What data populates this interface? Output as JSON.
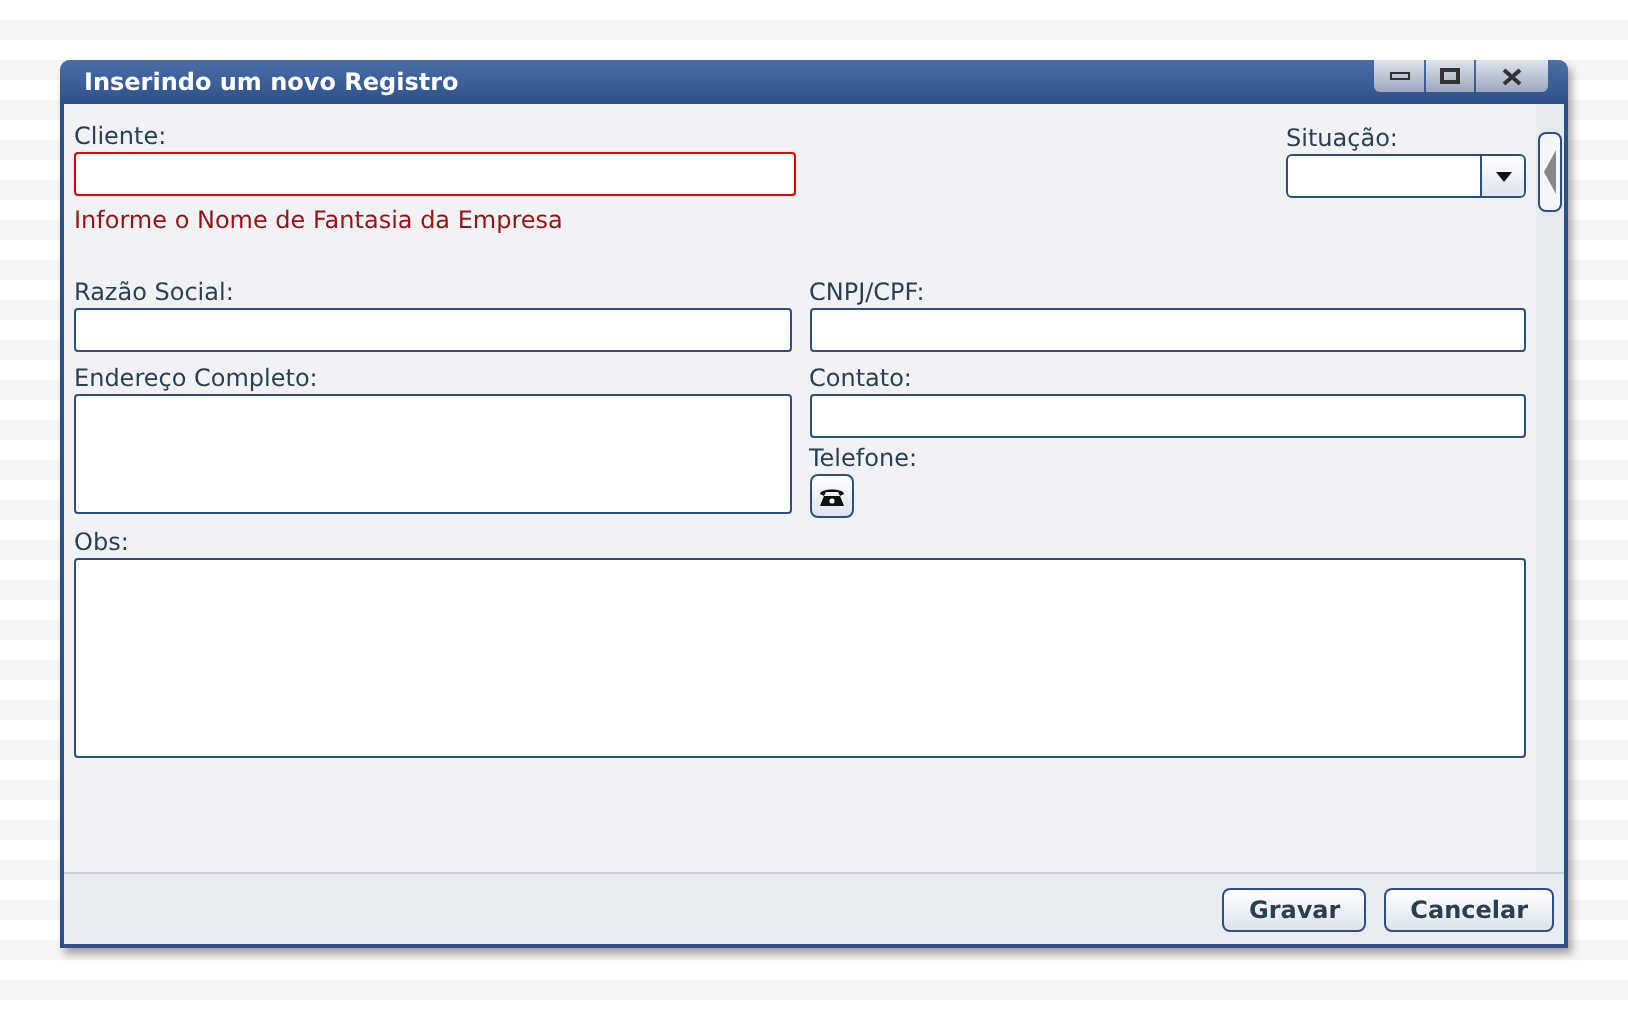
{
  "window": {
    "title": "Inserindo um novo Registro"
  },
  "cliente": {
    "label": "Cliente:",
    "invalid": true,
    "error": "Informe o Nome de Fantasia da Empresa"
  },
  "situacao": {
    "label": "Situação:"
  },
  "razao_social": {
    "label": "Razão Social:"
  },
  "cnpj_cpf": {
    "label": "CNPJ/CPF:"
  },
  "endereco": {
    "label": "Endereço Completo:"
  },
  "contato": {
    "label": "Contato:"
  },
  "telefone": {
    "label": "Telefone:"
  },
  "obs": {
    "label": "Obs:"
  },
  "buttons": [
    {
      "label": "Gravar"
    },
    {
      "label": "Cancelar"
    }
  ]
}
